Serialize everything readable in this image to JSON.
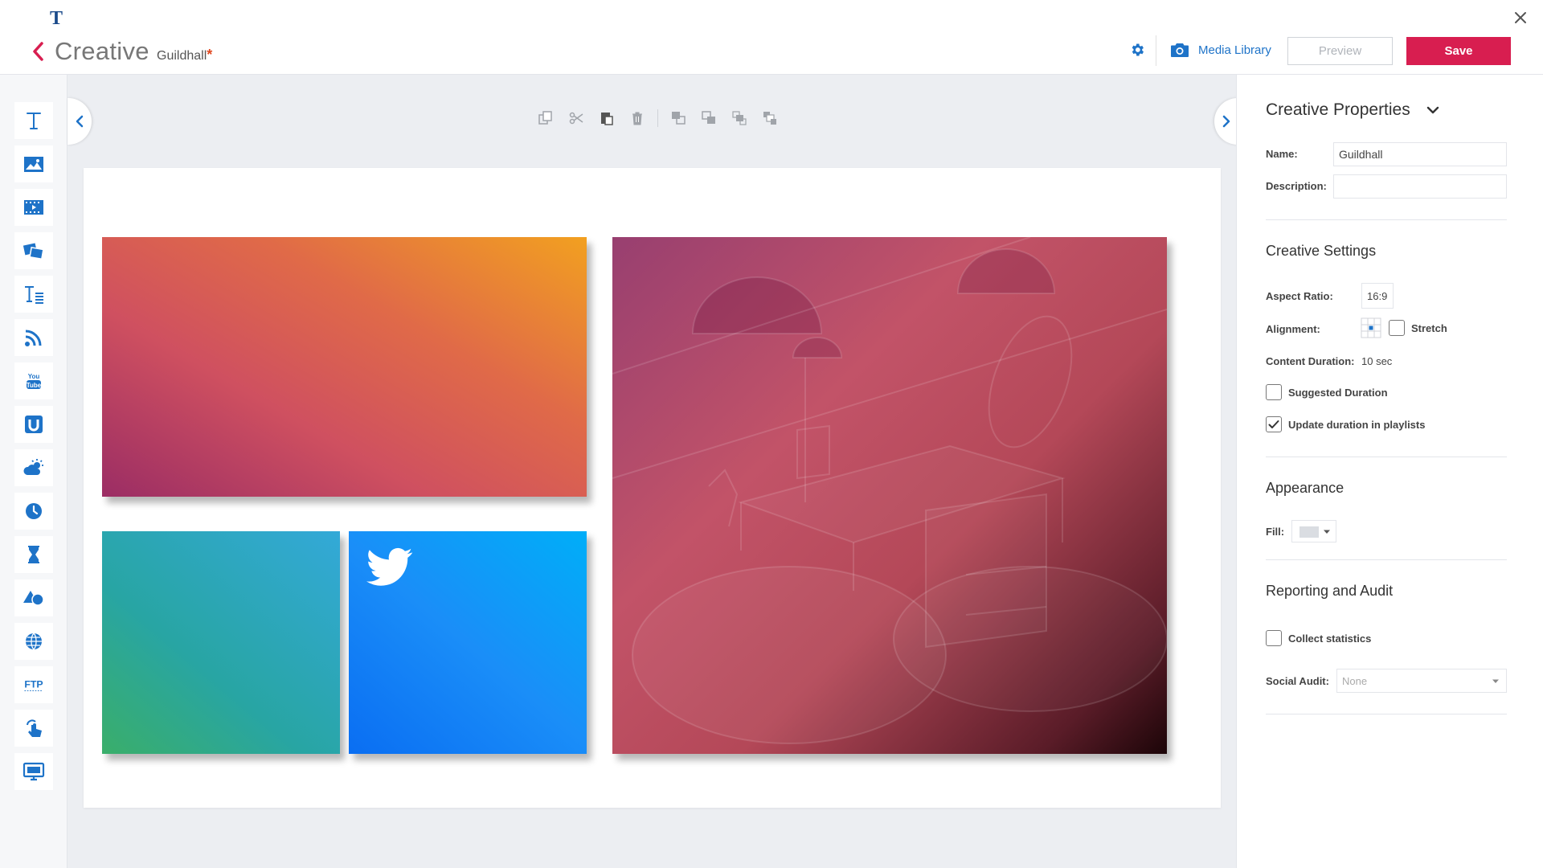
{
  "header": {
    "logo_letter": "T",
    "title": "Creative",
    "subtitle": "Guildhall",
    "unsaved_marker": "*",
    "media_library_label": "Media Library",
    "preview_label": "Preview",
    "save_label": "Save"
  },
  "left_tools": [
    {
      "name": "text-tool",
      "icon": "text-icon"
    },
    {
      "name": "image-tool",
      "icon": "image-icon"
    },
    {
      "name": "video-tool",
      "icon": "video-icon"
    },
    {
      "name": "slideshow-tool",
      "icon": "photos-icon"
    },
    {
      "name": "rich-text-tool",
      "icon": "text-block-icon"
    },
    {
      "name": "rss-tool",
      "icon": "rss-icon"
    },
    {
      "name": "youtube-tool",
      "icon": "youtube-icon"
    },
    {
      "name": "u-widget-tool",
      "icon": "u-icon"
    },
    {
      "name": "weather-tool",
      "icon": "weather-icon"
    },
    {
      "name": "clock-tool",
      "icon": "clock-icon"
    },
    {
      "name": "countdown-tool",
      "icon": "hourglass-icon"
    },
    {
      "name": "shapes-tool",
      "icon": "shapes-icon"
    },
    {
      "name": "web-tool",
      "icon": "globe-icon"
    },
    {
      "name": "ftp-tool",
      "icon": "ftp-icon",
      "text": "FTP"
    },
    {
      "name": "touch-tool",
      "icon": "touch-icon"
    },
    {
      "name": "screen-tool",
      "icon": "monitor-icon"
    }
  ],
  "toolbar": [
    "copy-icon",
    "cut-icon",
    "paste-icon",
    "delete-icon",
    "bring-forward-icon",
    "send-backward-icon",
    "bring-to-front-icon",
    "send-to-back-icon"
  ],
  "properties": {
    "title": "Creative Properties",
    "name_label": "Name:",
    "name_value": "Guildhall",
    "description_label": "Description:",
    "description_value": "",
    "settings_title": "Creative Settings",
    "aspect_ratio_label": "Aspect Ratio:",
    "aspect_ratio_value": "16:9",
    "alignment_label": "Alignment:",
    "stretch_label": "Stretch",
    "stretch_checked": false,
    "content_duration_label": "Content Duration:",
    "content_duration_value": "10 sec",
    "suggested_duration_label": "Suggested Duration",
    "suggested_duration_checked": false,
    "update_duration_label": "Update duration in playlists",
    "update_duration_checked": true,
    "appearance_title": "Appearance",
    "fill_label": "Fill:",
    "reporting_title": "Reporting and Audit",
    "collect_stats_label": "Collect statistics",
    "collect_stats_checked": false,
    "social_audit_label": "Social Audit:",
    "social_audit_value": "None"
  },
  "colors": {
    "accent": "#d81e50",
    "link": "#1e73c8",
    "tool_icon": "#1e73c8"
  }
}
